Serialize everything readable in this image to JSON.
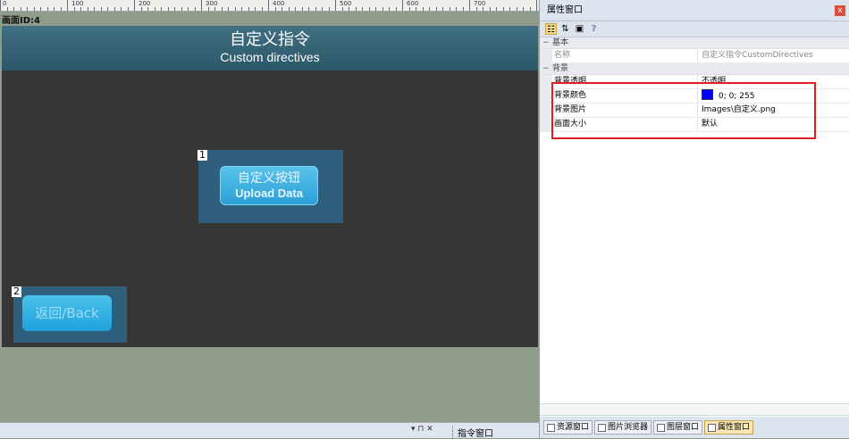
{
  "ruler": {
    "labels": [
      "0",
      "100",
      "200",
      "300",
      "400",
      "500",
      "600",
      "700"
    ]
  },
  "screen": {
    "id_label": "画面ID:4"
  },
  "canvas": {
    "title_cn": "自定义指令",
    "title_en": "Custom directives",
    "control1": {
      "number": "1",
      "label_cn": "自定义按钮",
      "label_en": "Upload Data"
    },
    "control2": {
      "number": "2",
      "label": "返回/Back"
    }
  },
  "bottom_bar": {
    "pin_controls": "▾ ⊓ ✕",
    "command_window": "指令窗口"
  },
  "properties": {
    "window_title": "属性窗口",
    "close_glyph": "x",
    "help_glyph": "?",
    "categories": [
      {
        "name": "基本",
        "toggle": "−",
        "rows": [
          {
            "name": "名称",
            "value": "自定义指令CustomDirectives"
          }
        ]
      },
      {
        "name": "背景",
        "toggle": "−",
        "rows": [
          {
            "name": "背景透明",
            "value": "不透明"
          },
          {
            "name": "背景颜色",
            "value": "0; 0; 255"
          },
          {
            "name": "背景图片",
            "value": "Images\\自定义.png"
          },
          {
            "name": "画面大小",
            "value": "默认"
          }
        ]
      }
    ],
    "swatch_color": "#0000ff",
    "tabs": [
      {
        "label": "资源窗口"
      },
      {
        "label": "图片浏览器"
      },
      {
        "label": "图层窗口"
      },
      {
        "label": "属性窗口",
        "active": true
      }
    ]
  },
  "colors": {
    "workspace": "#8f9c8a",
    "canvas": "#363636",
    "title_bar": "#2b5868",
    "control_box": "#2f5f7c",
    "button": "#2a9fd6",
    "highlight": "#e02020"
  }
}
